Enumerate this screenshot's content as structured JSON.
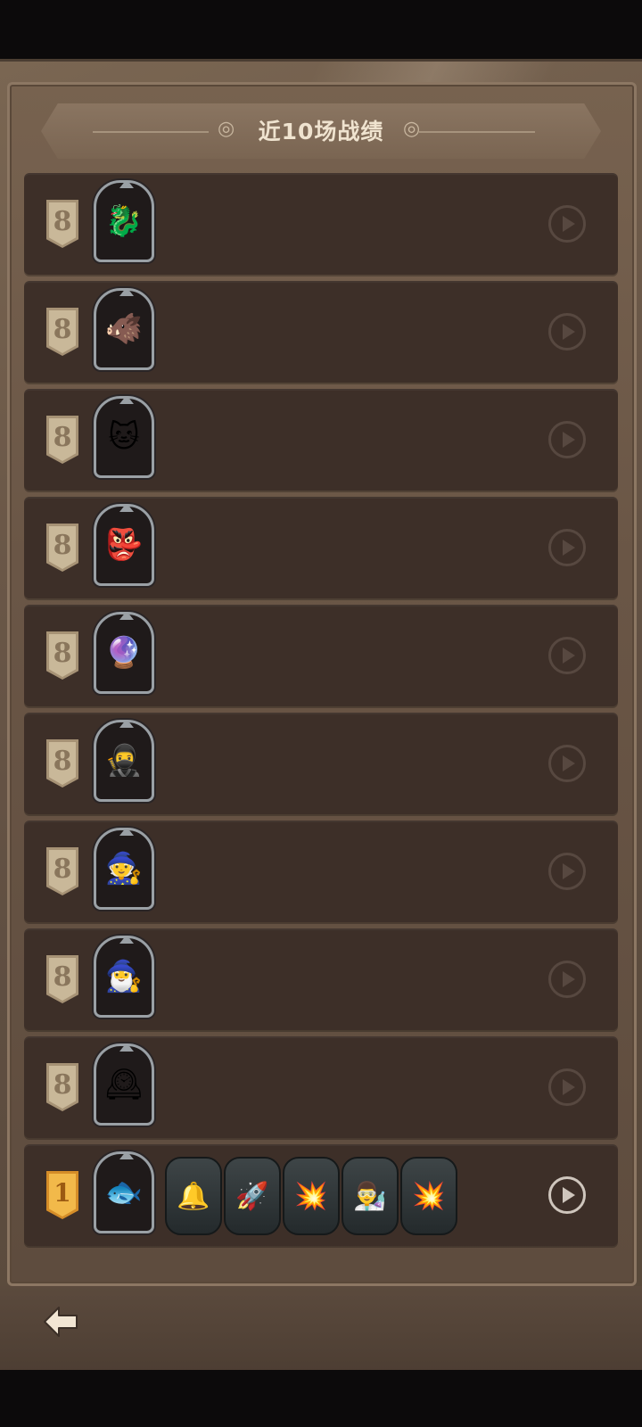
{
  "title": "近10场战绩",
  "title_ornament": "◎",
  "colors": {
    "panel": "#6a5646",
    "row": "#3d2f28",
    "rank_badge": "#c9b899",
    "rank_first": "#f2b94a",
    "replay_active": "#cfc6bd"
  },
  "matches": [
    {
      "rank": "8",
      "hero_icon": "purple-dragon-hero-icon",
      "glyph": "🐉",
      "replay_active": false
    },
    {
      "rank": "8",
      "hero_icon": "boar-hero-icon",
      "glyph": "🐗",
      "replay_active": false
    },
    {
      "rank": "8",
      "hero_icon": "top-hat-cat-hero-icon",
      "glyph": "🐱",
      "replay_active": false
    },
    {
      "rank": "8",
      "hero_icon": "goblin-hero-icon",
      "glyph": "👺",
      "replay_active": false
    },
    {
      "rank": "8",
      "hero_icon": "sorceress-hero-icon",
      "glyph": "🔮",
      "replay_active": false
    },
    {
      "rank": "8",
      "hero_icon": "hooded-rogue-hero-icon",
      "glyph": "🥷",
      "replay_active": false
    },
    {
      "rank": "8",
      "hero_icon": "witch-hero-icon",
      "glyph": "🧙",
      "replay_active": false
    },
    {
      "rank": "8",
      "hero_icon": "old-wizard-hero-icon",
      "glyph": "🧙‍♂️",
      "replay_active": false
    },
    {
      "rank": "8",
      "hero_icon": "clock-hero-icon",
      "glyph": "🕰",
      "replay_active": false
    },
    {
      "rank": "1",
      "hero_icon": "fish-man-hero-icon",
      "glyph": "🐟",
      "replay_active": true,
      "cards": [
        {
          "icon": "bell-machine-card-icon",
          "glyph": "🔔"
        },
        {
          "icon": "rocket-card-icon",
          "glyph": "🚀"
        },
        {
          "icon": "cannon-card-icon",
          "glyph": "💥"
        },
        {
          "icon": "mad-scientist-card-icon",
          "glyph": "👨‍🔬"
        },
        {
          "icon": "cannon-card-icon",
          "glyph": "💥"
        }
      ]
    }
  ]
}
